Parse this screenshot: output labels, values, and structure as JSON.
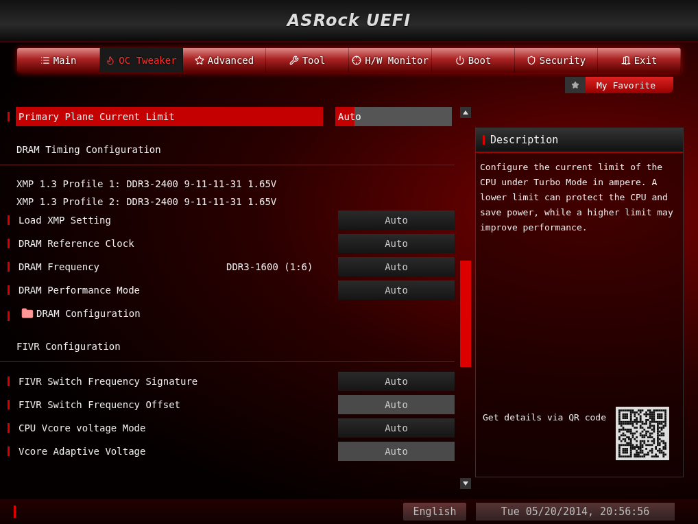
{
  "header": {
    "title": "ASRock UEFI"
  },
  "tabs": [
    {
      "label": "Main",
      "selected": false
    },
    {
      "label": "OC Tweaker",
      "selected": true
    },
    {
      "label": "Advanced",
      "selected": false
    },
    {
      "label": "Tool",
      "selected": false
    },
    {
      "label": "H/W Monitor",
      "selected": false
    },
    {
      "label": "Boot",
      "selected": false
    },
    {
      "label": "Security",
      "selected": false
    },
    {
      "label": "Exit",
      "selected": false
    }
  ],
  "favorite": {
    "label": "My Favorite"
  },
  "settings": [
    {
      "kind": "setting",
      "label": "Primary Plane Current Limit",
      "value": "Auto",
      "selected": true,
      "disabled": false
    },
    {
      "kind": "heading",
      "label": "DRAM Timing Configuration"
    },
    {
      "kind": "info",
      "label": "XMP 1.3 Profile 1: DDR3-2400 9-11-11-31 1.65V"
    },
    {
      "kind": "info",
      "label": "XMP 1.3 Profile 2: DDR3-2400 9-11-11-31 1.65V"
    },
    {
      "kind": "setting",
      "label": "Load XMP Setting",
      "value": "Auto",
      "selected": false,
      "disabled": false
    },
    {
      "kind": "setting",
      "label": "DRAM Reference Clock",
      "value": "Auto",
      "selected": false,
      "disabled": false
    },
    {
      "kind": "setting",
      "label": "DRAM Frequency",
      "extra": "DDR3-1600 (1:6)",
      "value": "Auto",
      "selected": false,
      "disabled": false
    },
    {
      "kind": "setting",
      "label": "DRAM Performance Mode",
      "value": "Auto",
      "selected": false,
      "disabled": false
    },
    {
      "kind": "folder",
      "label": "DRAM Configuration"
    },
    {
      "kind": "heading",
      "label": "FIVR Configuration"
    },
    {
      "kind": "setting",
      "label": "FIVR Switch Frequency Signature",
      "value": "Auto",
      "selected": false,
      "disabled": false
    },
    {
      "kind": "setting",
      "label": "FIVR Switch Frequency Offset",
      "value": "Auto",
      "selected": false,
      "disabled": true
    },
    {
      "kind": "setting",
      "label": "CPU Vcore voltage Mode",
      "value": "Auto",
      "selected": false,
      "disabled": false
    },
    {
      "kind": "setting",
      "label": "Vcore Adaptive Voltage",
      "value": "Auto",
      "selected": false,
      "disabled": true
    }
  ],
  "description": {
    "title": "Description",
    "text": "Configure the current limit of the CPU under Turbo Mode in ampere. A lower limit can protect the CPU and save power, while a higher limit may improve performance.",
    "qr_label": "Get details via QR code"
  },
  "status_bar": {
    "language": "English",
    "datetime": "Tue 05/20/2014, 20:56:56"
  }
}
